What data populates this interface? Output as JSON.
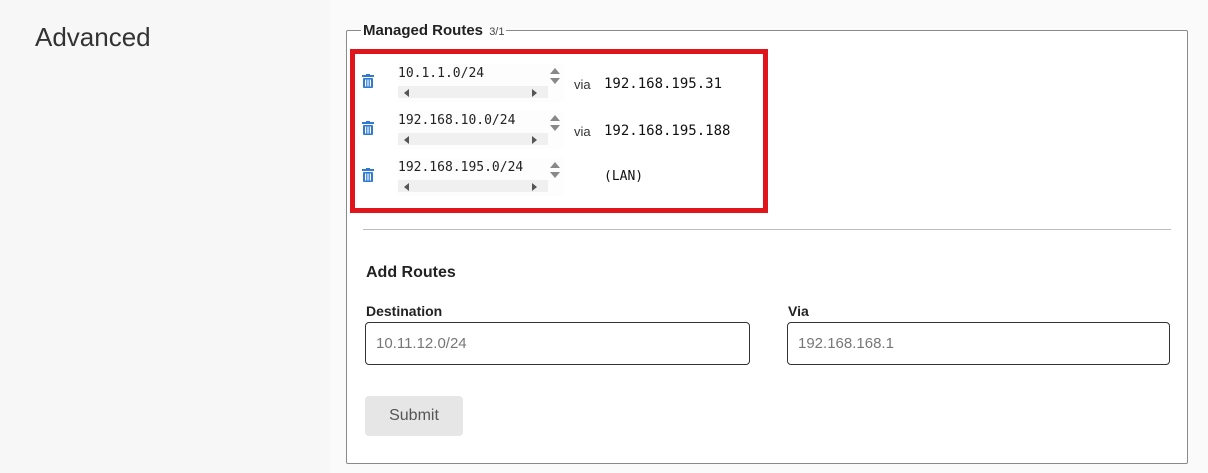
{
  "section": {
    "title": "Advanced"
  },
  "managed_routes": {
    "legend": "Managed Routes",
    "count": "3/1",
    "highlight_color": "#e0141b",
    "rows": [
      {
        "destination": "10.1.1.0/24",
        "via_label": "via",
        "via": "192.168.195.31",
        "icon": "trash-icon"
      },
      {
        "destination": "192.168.10.0/24",
        "via_label": "via",
        "via": "192.168.195.188",
        "icon": "trash-icon"
      },
      {
        "destination": "192.168.195.0/24",
        "via_label": "",
        "via": "(LAN)",
        "icon": "trash-icon"
      }
    ]
  },
  "add_routes": {
    "title": "Add Routes",
    "destination_label": "Destination",
    "destination_placeholder": "10.11.12.0/24",
    "via_label": "Via",
    "via_placeholder": "192.168.168.1",
    "submit_label": "Submit"
  },
  "colors": {
    "icon_blue": "#2f7bd4",
    "highlight": "#e0141b"
  }
}
